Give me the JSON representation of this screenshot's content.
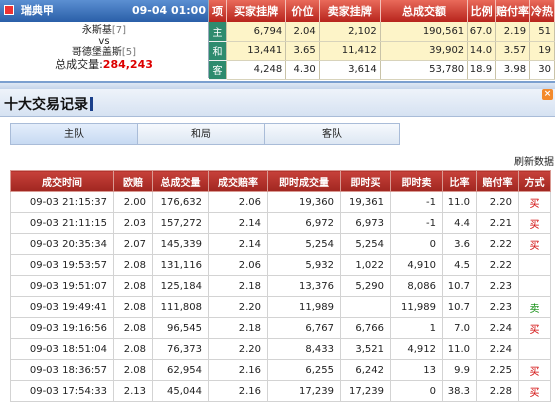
{
  "top": {
    "league": "瑞典甲",
    "datetime": "09-04 01:00",
    "home_team": "永斯基",
    "home_rank": "[7]",
    "vs": "vs",
    "away_team": "哥德堡盖斯",
    "away_rank": "[5]",
    "volume_label": "总成交量:",
    "volume": "284,243"
  },
  "summary": {
    "headers": [
      "项",
      "买家挂牌",
      "价位",
      "卖家挂牌",
      "总成交额",
      "比例",
      "赔付率",
      "冷热"
    ],
    "rows": [
      {
        "label": "主",
        "buy": "6,794",
        "price": "2.04",
        "sell": "2,102",
        "total": "190,561",
        "ratio": "67.0",
        "payout": "2.19",
        "heat": "51"
      },
      {
        "label": "和",
        "buy": "13,441",
        "price": "3.65",
        "sell": "11,412",
        "total": "39,902",
        "ratio": "14.0",
        "payout": "3.57",
        "heat": "19"
      },
      {
        "label": "客",
        "buy": "4,248",
        "price": "4.30",
        "sell": "3,614",
        "total": "53,780",
        "ratio": "18.9",
        "payout": "3.98",
        "heat": "30"
      }
    ]
  },
  "window": {
    "title": "十大交易记录",
    "close": "×",
    "tabs": [
      "主队",
      "和局",
      "客队"
    ],
    "refresh": "刷新数据"
  },
  "records": {
    "headers": [
      "成交时间",
      "欧赔",
      "总成交量",
      "成交赔率",
      "即时成交量",
      "即时买",
      "即时卖",
      "比率",
      "赔付率",
      "方式"
    ],
    "rows": [
      {
        "time": "09-03 21:15:37",
        "euro": "2.00",
        "volume": "176,632",
        "odds": "2.06",
        "instant": "19,360",
        "buy": "19,361",
        "sell": "-1",
        "ratio": "11.0",
        "payout": "2.20",
        "mode": "买",
        "type": "buy"
      },
      {
        "time": "09-03 21:11:15",
        "euro": "2.03",
        "volume": "157,272",
        "odds": "2.14",
        "instant": "6,972",
        "buy": "6,973",
        "sell": "-1",
        "ratio": "4.4",
        "payout": "2.21",
        "mode": "买",
        "type": "buy"
      },
      {
        "time": "09-03 20:35:34",
        "euro": "2.07",
        "volume": "145,339",
        "odds": "2.14",
        "instant": "5,254",
        "buy": "5,254",
        "sell": "0",
        "ratio": "3.6",
        "payout": "2.22",
        "mode": "买",
        "type": "buy"
      },
      {
        "time": "09-03 19:53:57",
        "euro": "2.08",
        "volume": "131,116",
        "odds": "2.06",
        "instant": "5,932",
        "buy": "1,022",
        "sell": "4,910",
        "ratio": "4.5",
        "payout": "2.22",
        "mode": "",
        "type": ""
      },
      {
        "time": "09-03 19:51:07",
        "euro": "2.08",
        "volume": "125,184",
        "odds": "2.18",
        "instant": "13,376",
        "buy": "5,290",
        "sell": "8,086",
        "ratio": "10.7",
        "payout": "2.23",
        "mode": "",
        "type": ""
      },
      {
        "time": "09-03 19:49:41",
        "euro": "2.08",
        "volume": "111,808",
        "odds": "2.20",
        "instant": "11,989",
        "buy": "",
        "sell": "11,989",
        "ratio": "10.7",
        "payout": "2.23",
        "mode": "卖",
        "type": "sell"
      },
      {
        "time": "09-03 19:16:56",
        "euro": "2.08",
        "volume": "96,545",
        "odds": "2.18",
        "instant": "6,767",
        "buy": "6,766",
        "sell": "1",
        "ratio": "7.0",
        "payout": "2.24",
        "mode": "买",
        "type": "buy"
      },
      {
        "time": "09-03 18:51:04",
        "euro": "2.08",
        "volume": "76,373",
        "odds": "2.20",
        "instant": "8,433",
        "buy": "3,521",
        "sell": "4,912",
        "ratio": "11.0",
        "payout": "2.24",
        "mode": "",
        "type": ""
      },
      {
        "time": "09-03 18:36:57",
        "euro": "2.08",
        "volume": "62,954",
        "odds": "2.16",
        "instant": "6,255",
        "buy": "6,242",
        "sell": "13",
        "ratio": "9.9",
        "payout": "2.25",
        "mode": "买",
        "type": "buy"
      },
      {
        "time": "09-03 17:54:33",
        "euro": "2.13",
        "volume": "45,044",
        "odds": "2.16",
        "instant": "17,239",
        "buy": "17,239",
        "sell": "0",
        "ratio": "38.3",
        "payout": "2.28",
        "mode": "买",
        "type": "buy"
      }
    ]
  }
}
